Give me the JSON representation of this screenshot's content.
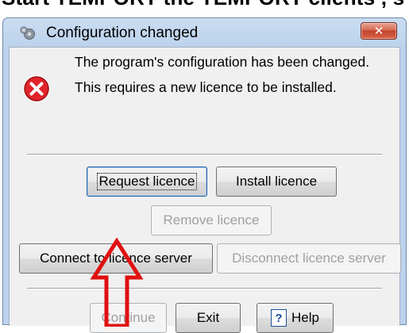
{
  "document": {
    "caption": "Start TEMPORT the TEMPORT clients , s"
  },
  "dialog": {
    "title": "Configuration changed",
    "close_glyph": "✕",
    "title_icon": "gears-icon",
    "message_icon": "error-icon",
    "message_lines": [
      "The program's configuration has been changed.",
      "This requires a new licence to be installed."
    ]
  },
  "buttons": {
    "request_licence": "Request licence",
    "install_licence": "Install licence",
    "remove_licence": "Remove licence",
    "connect_server": "Connect to licence server",
    "disconnect_server": "Disconnect licence server",
    "continue": "Continue",
    "exit": "Exit",
    "help": "Help",
    "help_icon": "?"
  },
  "annotation": {
    "arrow_color": "#e01010"
  },
  "colors": {
    "error_red": "#e0242a",
    "title_bar": "#bcd2ec",
    "close_red": "#c2422a"
  }
}
